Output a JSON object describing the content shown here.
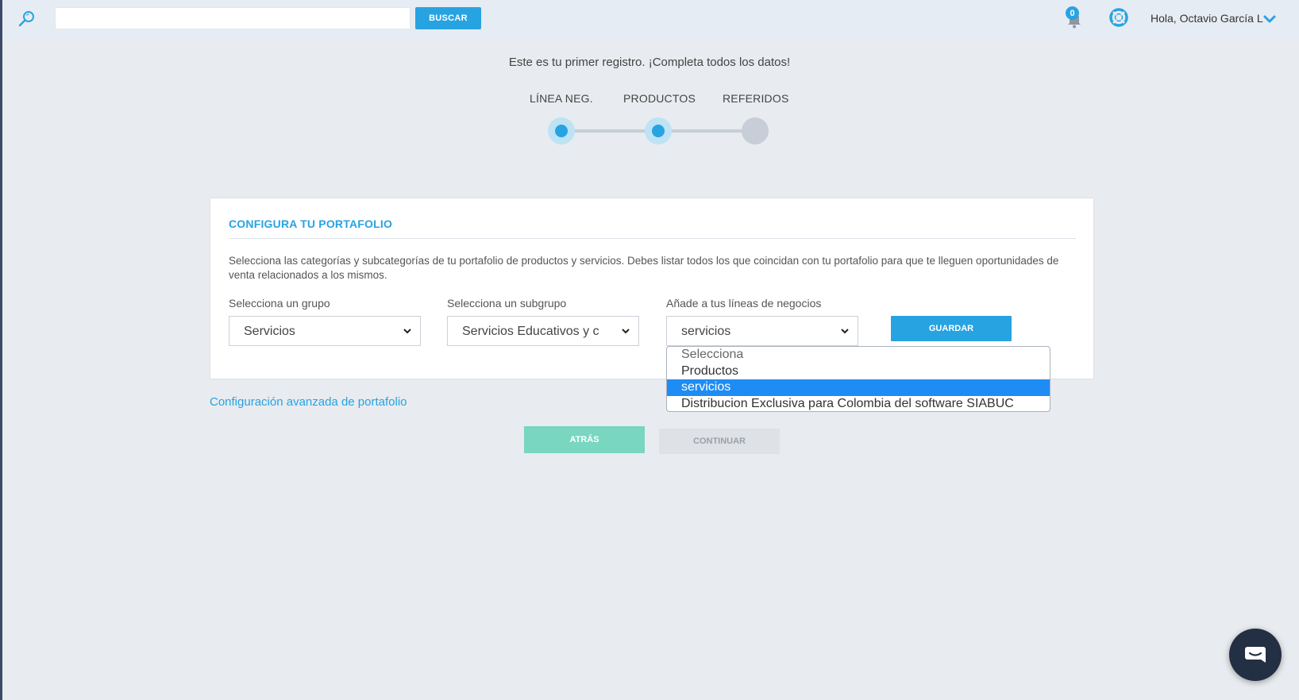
{
  "topbar": {
    "search_placeholder": "",
    "search_button": "BUSCAR",
    "notification_count": "0",
    "greeting": "Hola, Octavio García L"
  },
  "intro": "Este es tu primer registro. ¡Completa todos los datos!",
  "stepper": {
    "steps": [
      {
        "label": "LÍNEA NEG.",
        "state": "active"
      },
      {
        "label": "PRODUCTOS",
        "state": "active"
      },
      {
        "label": "REFERIDOS",
        "state": "inactive"
      }
    ]
  },
  "card": {
    "title": "CONFIGURA TU PORTAFOLIO",
    "description": "Selecciona las categorías y subcategorías de tu portafolio de productos y servicios. Debes listar todos los que coincidan con tu portafolio para que te lleguen oportunidades de venta relacionados a los mismos.",
    "group_label": "Selecciona un grupo",
    "group_value": "Servicios",
    "subgroup_label": "Selecciona un subgrupo",
    "subgroup_value": "Servicios Educativos y c",
    "lines_label": "Añade a tus líneas de negocios",
    "lines_value": "servicios",
    "save_button": "GUARDAR"
  },
  "dropdown": {
    "options": [
      "Selecciona",
      "Productos",
      "servicios",
      "Distribucion Exclusiva para Colombia del software SIABUC"
    ],
    "selected_index": 2
  },
  "advanced_link": "Configuración avanzada de portafolio",
  "actions": {
    "back": "ATRÁS",
    "continue": "CONTINUAR"
  },
  "colors": {
    "accent": "#27a3e2",
    "back_button": "#79d6c1",
    "disabled_button": "#dee1e5",
    "chat_button": "#232f42",
    "selected_option": "#1e8cf5"
  },
  "icons": [
    "search-icon",
    "bell-icon",
    "lifebuoy-icon",
    "chevron-down-icon",
    "chat-icon"
  ]
}
